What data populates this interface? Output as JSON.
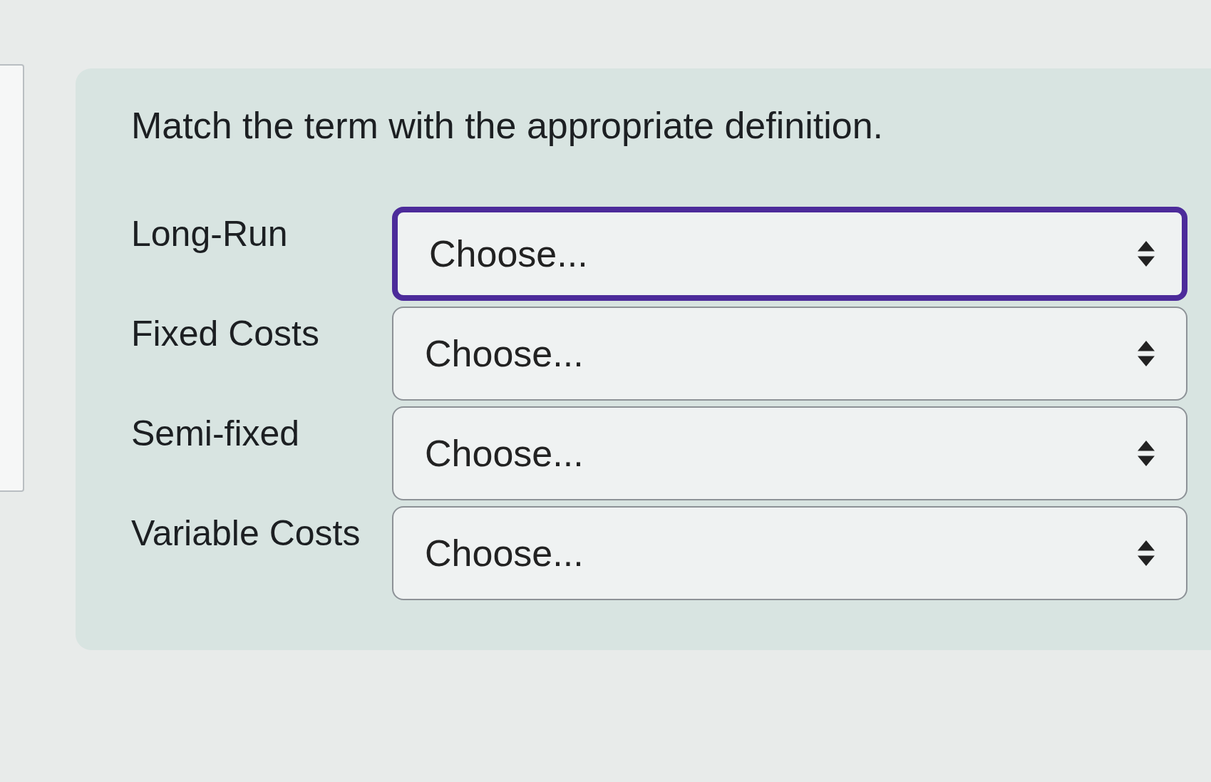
{
  "question": {
    "text": "Match the term with the appropriate definition."
  },
  "rows": [
    {
      "term": "Long-Run",
      "select": {
        "value": "Choose...",
        "focused": true
      }
    },
    {
      "term": "Fixed Costs",
      "select": {
        "value": "Choose...",
        "focused": false
      }
    },
    {
      "term": "Semi-fixed",
      "select": {
        "value": "Choose...",
        "focused": false
      }
    },
    {
      "term": "Variable Costs",
      "select": {
        "value": "Choose...",
        "focused": false
      }
    }
  ]
}
